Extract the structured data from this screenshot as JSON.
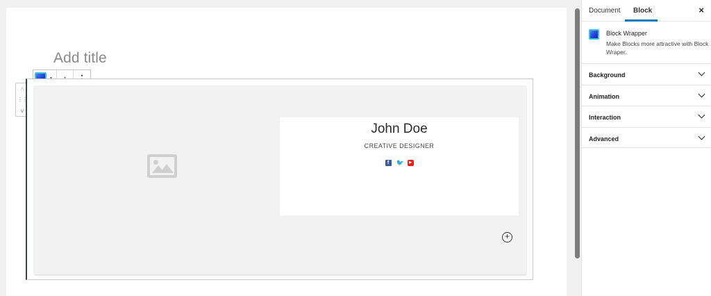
{
  "editor": {
    "title_placeholder": "Add title",
    "mover": {
      "up": "˄",
      "drag": "⋮⋮",
      "down": "˅"
    },
    "toolbar": {
      "caret": "▾",
      "move": "↕",
      "more": "⋮"
    }
  },
  "profile_card": {
    "name": "John Doe",
    "role": "CREATIVE DESIGNER",
    "socials": [
      {
        "icon": "facebook-icon",
        "glyph": "f"
      },
      {
        "icon": "twitter-icon",
        "glyph": "❤"
      },
      {
        "icon": "youtube-icon",
        "glyph": "▶"
      }
    ],
    "add_glyph": "+"
  },
  "sidebar": {
    "tabs": [
      {
        "label": "Document",
        "active": false
      },
      {
        "label": "Block",
        "active": true
      }
    ],
    "close_glyph": "×",
    "block": {
      "title": "Block Wrapper",
      "description": "Make Blocks more attractive with Block Wraper."
    },
    "panels": [
      {
        "label": "Background"
      },
      {
        "label": "Animation"
      },
      {
        "label": "Interaction"
      },
      {
        "label": "Advanced"
      }
    ]
  },
  "colors": {
    "accent": "#007cba",
    "block_icon": "#1b3fd6",
    "block_icon_border": "#3fc1d8",
    "facebook": "#3b5998",
    "twitter": "#1da1f2",
    "youtube": "#e62117"
  }
}
